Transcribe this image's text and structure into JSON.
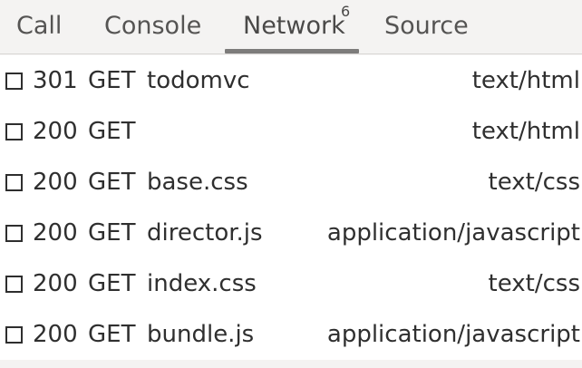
{
  "tabs": [
    {
      "label": "Call",
      "active": false
    },
    {
      "label": "Console",
      "active": false
    },
    {
      "label": "Network",
      "active": true,
      "badge": "6"
    },
    {
      "label": "Source",
      "active": false
    }
  ],
  "requests": [
    {
      "status": "301",
      "method": "GET",
      "name": "todomvc",
      "mime": "text/html"
    },
    {
      "status": "200",
      "method": "GET",
      "name": "",
      "mime": "text/html"
    },
    {
      "status": "200",
      "method": "GET",
      "name": "base.css",
      "mime": "text/css"
    },
    {
      "status": "200",
      "method": "GET",
      "name": "director.js",
      "mime": "application/javascript"
    },
    {
      "status": "200",
      "method": "GET",
      "name": "index.css",
      "mime": "text/css"
    },
    {
      "status": "200",
      "method": "GET",
      "name": "bundle.js",
      "mime": "application/javascript"
    }
  ]
}
